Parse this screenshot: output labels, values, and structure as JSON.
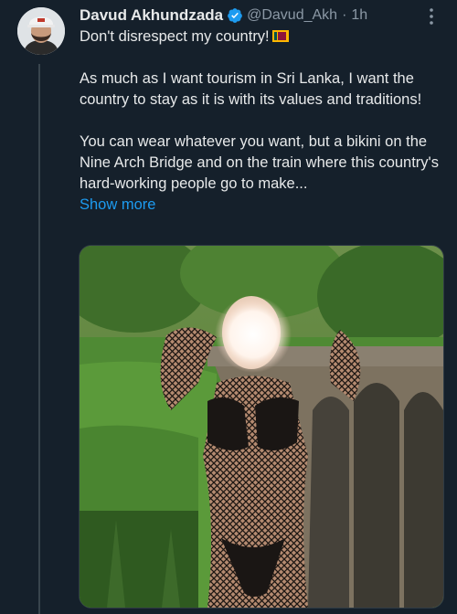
{
  "tweet": {
    "author_name": "Davud Akhundzada",
    "author_handle": "@Davud_Akh",
    "separator": "·",
    "time": "1h",
    "line1": "Don't disrespect my country!",
    "flag_icon": "sri-lanka-flag-emoji",
    "paragraph2": "As much as I want tourism in Sri Lanka, I want the country to stay as it is with its values and traditions!",
    "paragraph3": "You can wear whatever you want, but a bikini on the Nine Arch Bridge and on the train where this country's hard-working people go to make...",
    "show_more": "Show more"
  },
  "colors": {
    "background": "#15202b",
    "text": "#e7e9ea",
    "secondary": "#8b98a5",
    "link": "#1d9bf0",
    "verified": "#1d9bf0"
  },
  "icons": [
    "verified-badge-icon",
    "more-options-icon"
  ]
}
